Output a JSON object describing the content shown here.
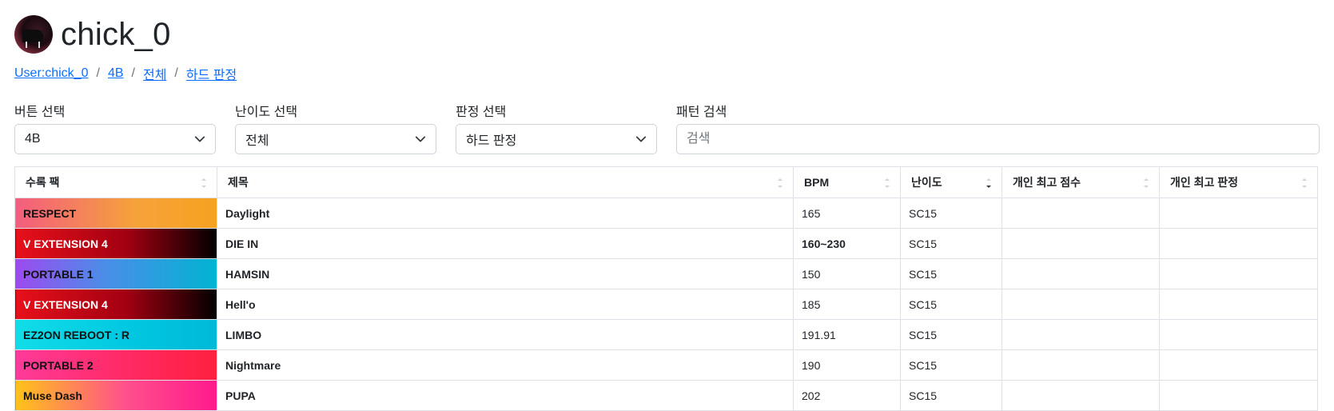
{
  "header": {
    "username": "chick_0"
  },
  "breadcrumb": [
    {
      "label": "User:chick_0"
    },
    {
      "label": "4B"
    },
    {
      "label": "전체"
    },
    {
      "label": "하드 판정"
    }
  ],
  "filters": {
    "button": {
      "label": "버튼 선택",
      "value": "4B"
    },
    "difficulty": {
      "label": "난이도 선택",
      "value": "전체"
    },
    "judgement": {
      "label": "판정 선택",
      "value": "하드 판정"
    },
    "search": {
      "label": "패턴 검색",
      "placeholder": "검색",
      "value": ""
    }
  },
  "table": {
    "columns": [
      "수록 팩",
      "제목",
      "BPM",
      "난이도",
      "개인 최고 점수",
      "개인 최고 판정"
    ],
    "rows": [
      {
        "pack": "RESPECT",
        "title": "Daylight",
        "bpm": "165",
        "difficulty": "SC15",
        "best_score": "",
        "best_judgement": "",
        "pack_gradient": "linear-gradient(90deg, #f35d7f 0%, #f6a23a 60%, #f5a220 100%)",
        "pack_text": "#111111"
      },
      {
        "pack": "V EXTENSION 4",
        "title": "DIE IN",
        "bpm": "160~230",
        "difficulty": "SC15",
        "best_score": "",
        "best_judgement": "",
        "pack_gradient": "linear-gradient(90deg, #e8101a 0%, #a20012 55%, #000000 100%)",
        "pack_text": "#ffffff",
        "bpm_bold": true
      },
      {
        "pack": "PORTABLE 1",
        "title": "HAMSIN",
        "bpm": "150",
        "difficulty": "SC15",
        "best_score": "",
        "best_judgement": "",
        "pack_gradient": "linear-gradient(90deg, #9d4af0 0%, #4a8ee8 45%, #00b4d2 100%)",
        "pack_text": "#111111"
      },
      {
        "pack": "V EXTENSION 4",
        "title": "Hell'o",
        "bpm": "185",
        "difficulty": "SC15",
        "best_score": "",
        "best_judgement": "",
        "pack_gradient": "linear-gradient(90deg, #e8101a 0%, #a20012 55%, #000000 100%)",
        "pack_text": "#ffffff"
      },
      {
        "pack": "EZ2ON REBOOT : R",
        "title": "LIMBO",
        "bpm": "191.91",
        "difficulty": "SC15",
        "best_score": "",
        "best_judgement": "",
        "pack_gradient": "linear-gradient(90deg, #11dde8 0%, #00c6e0 60%, #00b9d8 100%)",
        "pack_text": "#111111"
      },
      {
        "pack": "PORTABLE 2",
        "title": "Nightmare",
        "bpm": "190",
        "difficulty": "SC15",
        "best_score": "",
        "best_judgement": "",
        "pack_gradient": "linear-gradient(90deg, #ff3a9a 0%, #ff2a64 55%, #ff2040 100%)",
        "pack_text": "#111111"
      },
      {
        "pack": "Muse Dash",
        "title": "PUPA",
        "bpm": "202",
        "difficulty": "SC15",
        "best_score": "",
        "best_judgement": "",
        "pack_gradient": "linear-gradient(90deg, #ffc21a 0%, #ff4f8c 55%, #ff1a8c 100%)",
        "pack_text": "#111111"
      }
    ]
  },
  "colors": {
    "link": "#0d6efd",
    "border": "#dee2e6"
  }
}
